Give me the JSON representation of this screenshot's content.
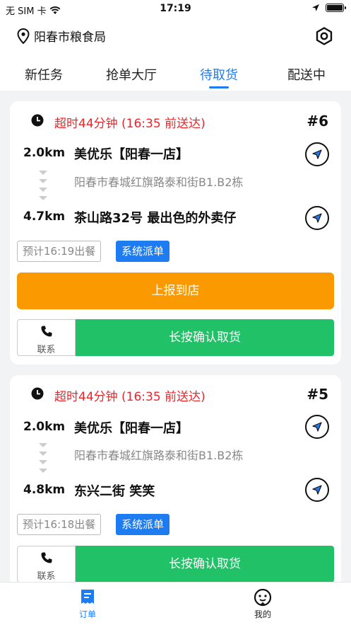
{
  "status_bar": {
    "carrier": "无 SIM 卡",
    "time": "17:19"
  },
  "header": {
    "location": "阳春市粮食局"
  },
  "tabs": [
    {
      "label": "新任务"
    },
    {
      "label": "抢单大厅"
    },
    {
      "label": "待取货",
      "active": true
    },
    {
      "label": "配送中"
    }
  ],
  "orders": [
    {
      "overdue_text": "超时44分钟 (16:35 前送达)",
      "number": "#6",
      "pickup": {
        "distance": "2.0km",
        "name": "美优乐【阳春一店】",
        "address": "阳春市春城红旗路泰和街B1.B2栋"
      },
      "dropoff": {
        "distance": "4.7km",
        "name": "茶山路32号 最出色的外卖仔"
      },
      "meal_time": "预计16:19出餐",
      "dispatch_tag": "系统派单",
      "report_label": "上报到店",
      "contact_label": "联系",
      "confirm_label": "长按确认取货"
    },
    {
      "overdue_text": "超时44分钟 (16:35 前送达)",
      "number": "#5",
      "pickup": {
        "distance": "2.0km",
        "name": "美优乐【阳春一店】",
        "address": "阳春市春城红旗路泰和街B1.B2栋"
      },
      "dropoff": {
        "distance": "4.8km",
        "name": "东兴二街 笑笑"
      },
      "meal_time": "预计16:18出餐",
      "dispatch_tag": "系统派单",
      "contact_label": "联系",
      "confirm_label": "长按确认取货"
    }
  ],
  "bottom_nav": [
    {
      "label": "订单",
      "icon": "order-icon",
      "active": true
    },
    {
      "label": "我的",
      "icon": "profile-icon"
    }
  ],
  "colors": {
    "accent": "#1e7cf2",
    "overdue": "#e8272b",
    "report": "#fb9a00",
    "confirm": "#21c167"
  }
}
